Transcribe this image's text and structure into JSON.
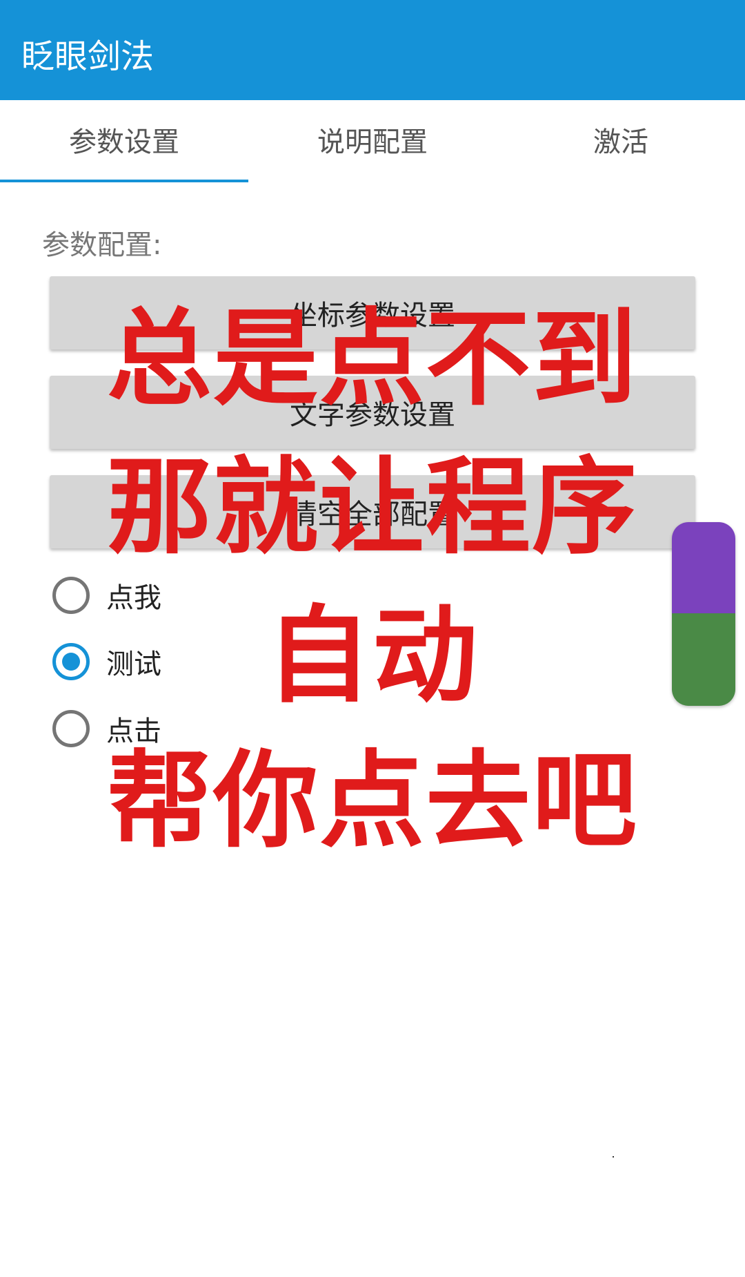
{
  "app": {
    "title": "眨眼剑法",
    "accent_color": "#1592d7"
  },
  "tabs": [
    {
      "label": "参数设置",
      "selected": true
    },
    {
      "label": "说明配置",
      "selected": false
    },
    {
      "label": "激活",
      "selected": false
    }
  ],
  "main": {
    "section_label": "参数配置:",
    "buttons": [
      {
        "label": "坐标参数设置"
      },
      {
        "label": "文字参数设置"
      },
      {
        "label": "清空全部配置"
      }
    ],
    "radios": [
      {
        "label": "点我",
        "checked": false
      },
      {
        "label": "测试",
        "checked": true
      },
      {
        "label": "点击",
        "checked": false
      }
    ]
  },
  "overlay": {
    "color": "#e01b1b",
    "lines": [
      "总是点不到",
      "那就让程序",
      "自动",
      "帮你点去吧"
    ]
  },
  "floating_widget": {
    "top_color": "#7b42bd",
    "bottom_color": "#4a8a46"
  }
}
